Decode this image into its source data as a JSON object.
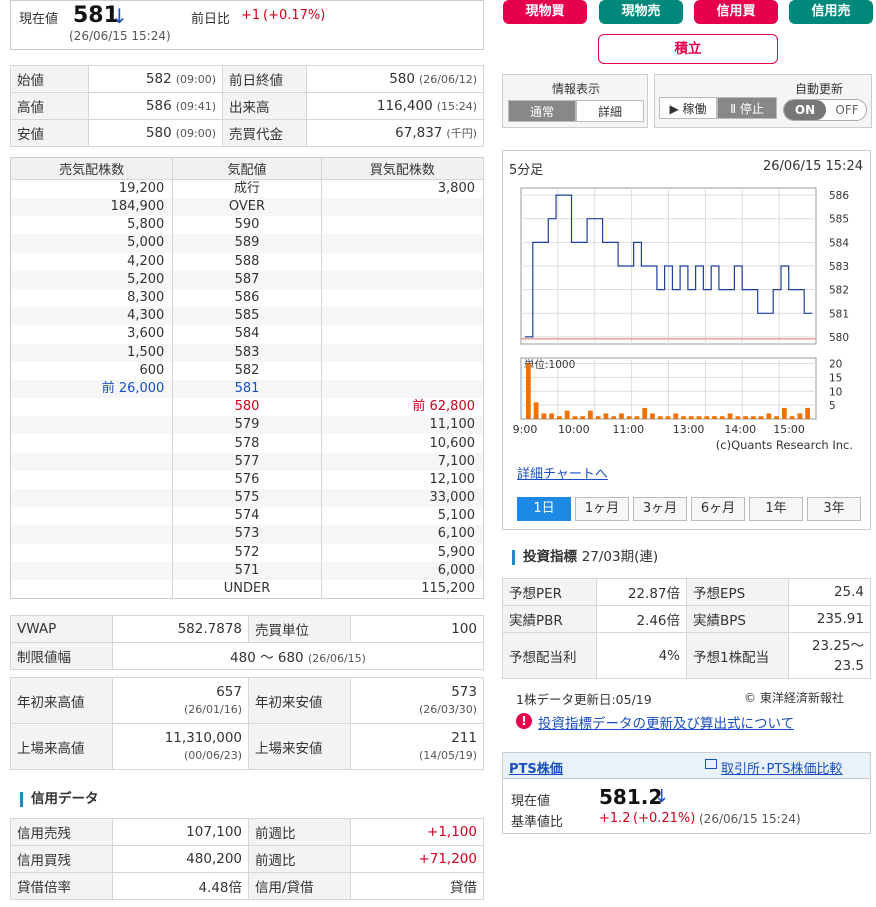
{
  "price": {
    "label": "現在値",
    "value": "581",
    "arrow": "↓",
    "time": "(26/06/15 15:24)",
    "change_label": "前日比",
    "change": "+1",
    "change_pct": "(+0.17%)"
  },
  "ohlc": [
    {
      "l1": "始値",
      "v1": "582",
      "t1": "(09:00)",
      "l2": "前日終値",
      "v2": "580",
      "t2": "(26/06/12)"
    },
    {
      "l1": "高値",
      "v1": "586",
      "t1": "(09:41)",
      "l2": "出来高",
      "v2": "116,400",
      "t2": "(15:24)"
    },
    {
      "l1": "安値",
      "v1": "580",
      "t1": "(09:00)",
      "l2": "売買代金",
      "v2": "67,837",
      "t2": "(千円)"
    }
  ],
  "book": {
    "headers": [
      "売気配株数",
      "気配値",
      "買気配株数"
    ],
    "rows": [
      {
        "sell": "19,200",
        "price": "成行",
        "buy": "3,800"
      },
      {
        "sell": "184,900",
        "price": "OVER",
        "buy": ""
      },
      {
        "sell": "5,800",
        "price": "590",
        "buy": ""
      },
      {
        "sell": "5,000",
        "price": "589",
        "buy": ""
      },
      {
        "sell": "4,200",
        "price": "588",
        "buy": ""
      },
      {
        "sell": "5,200",
        "price": "587",
        "buy": ""
      },
      {
        "sell": "8,300",
        "price": "586",
        "buy": ""
      },
      {
        "sell": "4,300",
        "price": "585",
        "buy": ""
      },
      {
        "sell": "3,600",
        "price": "584",
        "buy": ""
      },
      {
        "sell": "1,500",
        "price": "583",
        "buy": ""
      },
      {
        "sell": "600",
        "price": "582",
        "buy": ""
      },
      {
        "sell": "前 26,000",
        "price": "581",
        "buy": "",
        "hl": "blue"
      },
      {
        "sell": "",
        "price": "580",
        "buy": "前 62,800",
        "hl": "red"
      },
      {
        "sell": "",
        "price": "579",
        "buy": "11,100"
      },
      {
        "sell": "",
        "price": "578",
        "buy": "10,600"
      },
      {
        "sell": "",
        "price": "577",
        "buy": "7,100"
      },
      {
        "sell": "",
        "price": "576",
        "buy": "12,100"
      },
      {
        "sell": "",
        "price": "575",
        "buy": "33,000"
      },
      {
        "sell": "",
        "price": "574",
        "buy": "5,100"
      },
      {
        "sell": "",
        "price": "573",
        "buy": "6,100"
      },
      {
        "sell": "",
        "price": "572",
        "buy": "5,900"
      },
      {
        "sell": "",
        "price": "571",
        "buy": "6,000"
      },
      {
        "sell": "",
        "price": "UNDER",
        "buy": "115,200"
      }
    ]
  },
  "vwap": {
    "label": "VWAP",
    "value": "582.7878",
    "unit_label": "売買単位",
    "unit": "100",
    "limit_label": "制限値幅",
    "limit": "480 〜 680",
    "limit_date": "(26/06/15)"
  },
  "ranges": {
    "ytd_high_label": "年初来高値",
    "ytd_high": "657",
    "ytd_high_date": "(26/01/16)",
    "ytd_low_label": "年初来安値",
    "ytd_low": "573",
    "ytd_low_date": "(26/03/30)",
    "all_high_label": "上場来高値",
    "all_high": "11,310,000",
    "all_high_date": "(00/06/23)",
    "all_low_label": "上場来安値",
    "all_low": "211",
    "all_low_date": "(14/05/19)"
  },
  "credit": {
    "title": "信用データ",
    "rows": [
      {
        "l1": "信用売残",
        "v1": "107,100",
        "l2": "前週比",
        "v2": "+1,100"
      },
      {
        "l1": "信用買残",
        "v1": "480,200",
        "l2": "前週比",
        "v2": "+71,200"
      },
      {
        "l1": "貸借倍率",
        "v1": "4.48倍",
        "l2": "信用/貸借",
        "v2": "貸借"
      }
    ]
  },
  "trade_buttons": [
    "現物買",
    "現物売",
    "信用買",
    "信用売"
  ],
  "tsumitate": "積立",
  "info_display": {
    "title": "情報表示",
    "opt1": "通常",
    "opt2": "詳細"
  },
  "auto_update": {
    "title": "自動更新",
    "run": "▶ 稼働",
    "stop": "Ⅱ 停止",
    "on": "ON",
    "off": "OFF"
  },
  "chart_header": {
    "interval": "5分足",
    "time": "26/06/15 15:24"
  },
  "chart_data": {
    "type": "line",
    "price_axis": [
      586,
      585,
      584,
      583,
      582,
      581,
      580
    ],
    "volume_axis": [
      20,
      15,
      10,
      5
    ],
    "volume_unit": "単位:1000",
    "x_ticks": [
      "9:00",
      "10:00",
      "11:00",
      "13:00",
      "14:00",
      "15:00"
    ],
    "price": [
      580,
      584,
      584,
      585,
      586,
      586,
      584,
      584,
      585,
      585,
      584,
      584,
      583,
      583,
      584,
      583,
      583,
      582,
      583,
      582,
      583,
      582,
      583,
      582,
      583,
      582,
      582,
      583,
      582,
      582,
      581,
      581,
      582,
      583,
      582,
      582,
      581
    ],
    "volume": [
      20,
      6,
      2,
      2,
      1,
      3,
      1,
      1,
      3,
      1,
      2,
      1,
      2,
      1,
      1,
      4,
      2,
      1,
      1,
      2,
      1,
      1,
      1,
      1,
      1,
      1,
      2,
      1,
      1,
      1,
      1,
      2,
      1,
      4,
      1,
      2,
      4
    ],
    "prev_close": 580,
    "credit": "(c)Quants Research Inc."
  },
  "detail_link": "詳細チャートへ",
  "periods": [
    "1日",
    "1ヶ月",
    "3ヶ月",
    "6ヶ月",
    "1年",
    "3年"
  ],
  "metrics": {
    "title": "投資指標",
    "period": "27/03期(連)",
    "rows": [
      {
        "l1": "予想PER",
        "v1": "22.87倍",
        "l2": "予想EPS",
        "v2": "25.4"
      },
      {
        "l1": "実績PBR",
        "v1": "2.46倍",
        "l2": "実績BPS",
        "v2": "235.91"
      },
      {
        "l1": "予想配当利",
        "v1": "4%",
        "l2": "予想1株配当",
        "v2a": "23.25〜",
        "v2b": "23.5"
      }
    ],
    "update": "1株データ更新日:05/19",
    "source": "© 東洋経済新報社",
    "note_link": "投資指標データの更新及び算出式について"
  },
  "pts": {
    "title": "PTS株価",
    "compare_link": "取引所･PTS株価比較",
    "price_label": "現在値",
    "price": "581.2",
    "arrow": "↓",
    "base_label": "基準値比",
    "change": "+1.2",
    "change_pct": "(+0.21%)",
    "time": "(26/06/15 15:24)"
  },
  "colors": {
    "accent_red": "#e6004c",
    "accent_green": "#00897b",
    "line": "#1f3f9a",
    "volume": "#f07000"
  }
}
